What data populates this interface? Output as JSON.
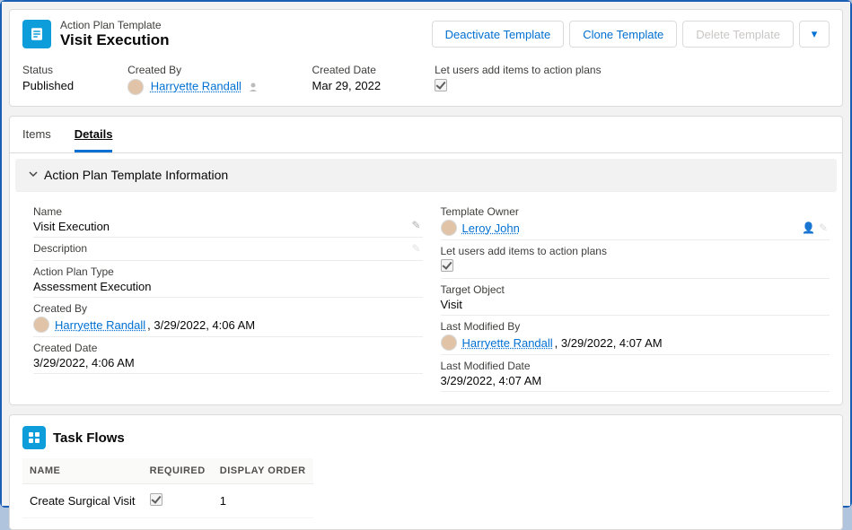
{
  "header": {
    "object_label": "Action Plan Template",
    "title": "Visit Execution",
    "actions": {
      "deactivate": "Deactivate Template",
      "clone": "Clone Template",
      "delete": "Delete Template"
    },
    "meta": {
      "status_label": "Status",
      "status_value": "Published",
      "createdby_label": "Created By",
      "createdby_user": "Harryette Randall",
      "createddate_label": "Created Date",
      "createddate_value": "Mar 29, 2022",
      "letusers_label": "Let users add items to action plans"
    }
  },
  "tabs": {
    "items": "Items",
    "details": "Details"
  },
  "section": {
    "title": "Action Plan Template Information"
  },
  "details": {
    "left": {
      "name_label": "Name",
      "name_value": "Visit Execution",
      "desc_label": "Description",
      "desc_value": "",
      "type_label": "Action Plan Type",
      "type_value": "Assessment Execution",
      "createdby_label": "Created By",
      "createdby_user": "Harryette Randall",
      "createdby_suffix": ", 3/29/2022, 4:06 AM",
      "createddate_label": "Created Date",
      "createddate_value": "3/29/2022, 4:06 AM"
    },
    "right": {
      "owner_label": "Template Owner",
      "owner_user": "Leroy John",
      "letusers_label": "Let users add items to action plans",
      "target_label": "Target Object",
      "target_value": "Visit",
      "modby_label": "Last Modified By",
      "modby_user": "Harryette Randall",
      "modby_suffix": ", 3/29/2022, 4:07 AM",
      "moddate_label": "Last Modified Date",
      "moddate_value": "3/29/2022, 4:07 AM"
    }
  },
  "taskflows": {
    "title": "Task Flows",
    "cols": {
      "name": "NAME",
      "required": "REQUIRED",
      "order": "DISPLAY ORDER"
    },
    "rows": [
      {
        "name": "Create Surgical Visit",
        "required": true,
        "order": "1"
      }
    ]
  }
}
